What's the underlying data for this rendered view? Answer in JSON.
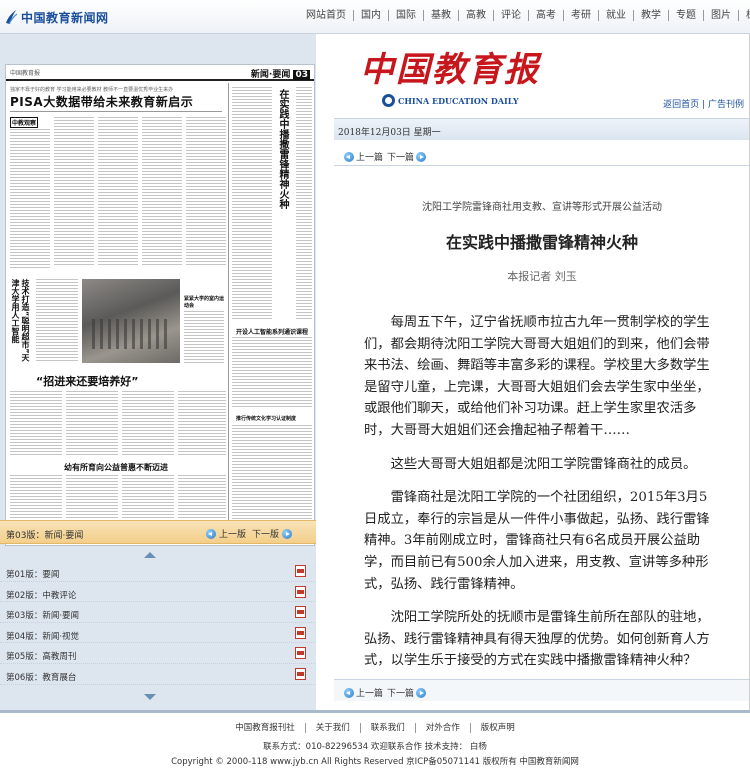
{
  "header": {
    "logo_text": "中国教育新闻网",
    "nav": [
      "网站首页",
      "国内",
      "国际",
      "基教",
      "高教",
      "评论",
      "高考",
      "考研",
      "就业",
      "教学",
      "专题",
      "图片",
      "栋学"
    ]
  },
  "paper_image": {
    "masthead": "中国教育报",
    "section": "新闻·要闻",
    "page_no": "03",
    "kicker": "独家不靠于好的教育 学习能用来必要教材 教师不一直要温优秀毕业生来办",
    "headline1": "PISA大数据带给未来教育新启示",
    "headline2": "“招进来还要培养好”",
    "headline3": "幼有所育向公益普惠不断迈进",
    "vertical1": "在实践中播撒雷锋精神火种",
    "vertical2": "技术打造“聪明超市”天津大学用人工智能",
    "side1": "开设人工智能系列通识课程",
    "side2": "推行传统文化学习认证制度",
    "side3": "紧紧大学的室内运动会",
    "col_label": "中教观察"
  },
  "page_bar": {
    "current": "第03版：新闻·要闻",
    "prev": "上一版",
    "next": "下一版"
  },
  "page_list": [
    "第01版：要闻",
    "第02版：中教评论",
    "第03版：新闻·要闻",
    "第04版：新闻·视觉",
    "第05版：高教周刊",
    "第06版：教育展台"
  ],
  "masthead": {
    "title": "中国教育报",
    "en": "CHINA EDUCATION DAILY",
    "home": "返回首页",
    "sep": "|",
    "ads": "广告刊例"
  },
  "date": "2018年12月03日 星期一",
  "article_nav": {
    "prev": "上一篇",
    "next": "下一篇"
  },
  "article": {
    "subtitle": "沈阳工学院雷锋商社用支教、宣讲等形式开展公益活动",
    "title": "在实践中播撒雷锋精神火种",
    "author": "本报记者 刘玉",
    "paragraphs": [
      "每周五下午，辽宁省抚顺市拉古九年一贯制学校的学生们，都会期待沈阳工学院大哥哥大姐姐们的到来，他们会带来书法、绘画、舞蹈等丰富多彩的课程。学校里大多数学生是留守儿童，上完课，大哥哥大姐姐们会去学生家中坐坐，或跟他们聊天，或给他们补习功课。赶上学生家里农活多时，大哥哥大姐姐们还会撸起袖子帮着干……",
      "这些大哥哥大姐姐都是沈阳工学院雷锋商社的成员。",
      "雷锋商社是沈阳工学院的一个社团组织，2015年3月5日成立，奉行的宗旨是从一件件小事做起，弘扬、践行雷锋精神。3年前刚成立时，雷锋商社只有6名成员开展公益助学，而目前已有500余人加入进来，用支教、宣讲等多种形式，弘扬、践行雷锋精神。",
      "沈阳工学院所处的抚顺市是雷锋生前所在部队的驻地，弘扬、践行雷锋精神具有得天独厚的优势。如何创新育人方式，以学生乐于接受的方式在实践中播撒雷锋精神火种？"
    ]
  },
  "footer": {
    "links": [
      "中国教育报刊社",
      "关于我们",
      "联系我们",
      "对外合作",
      "版权声明"
    ],
    "contact": "联系方式：010-82296534 欢迎联系合作 技术支持： 白杨",
    "copyright": "Copyright © 2000-118 www.jyb.cn All Rights Reserved 京ICP备05071141 版权所有 中国教育新闻网"
  },
  "colors": {
    "brand_blue": "#1b4e9b",
    "brand_red": "#c8161d",
    "page_bar": "#f3cf8a"
  }
}
